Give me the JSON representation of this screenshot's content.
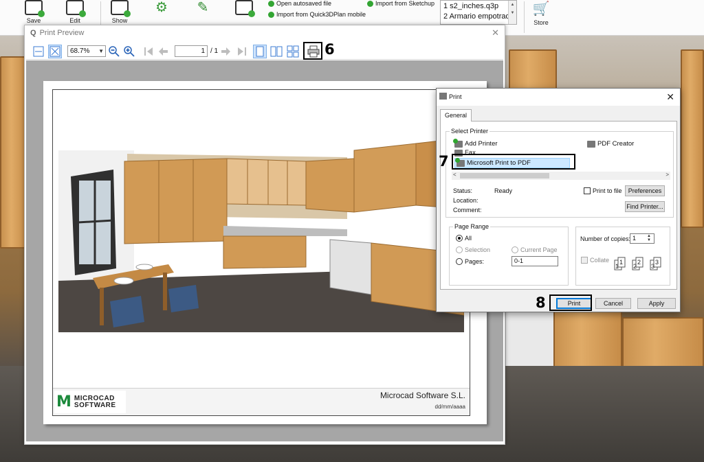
{
  "ribbon": {
    "buttons": [
      {
        "label": "Save",
        "icon": "save-icon"
      },
      {
        "label": "Edit",
        "icon": "edit-icon"
      },
      {
        "label": "Show",
        "icon": "show-icon"
      }
    ],
    "links": {
      "open_autosaved": "Open autosaved file",
      "import_quick3d": "Import from Quick3DPlan mobile",
      "import_sketchup": "Import from Sketchup"
    },
    "recent_files": [
      "1 s2_inches.q3p",
      "2 Armario empotrad"
    ],
    "store_label": "Store"
  },
  "preview": {
    "title": "Print Preview",
    "zoom": "68.7%",
    "page_current": "1",
    "page_total": "/ 1",
    "footer_company": "Microcad Software S.L.",
    "footer_date": "dd/mm/aaaa",
    "logo_line1": "MICROCAD",
    "logo_line2": "SOFTWARE"
  },
  "dialog": {
    "title": "Print",
    "tab_general": "General",
    "select_printer_label": "Select Printer",
    "printers": {
      "add_printer": "Add Printer",
      "fax": "Fax",
      "ms_pdf": "Microsoft Print to PDF",
      "pdf_creator": "PDF Creator"
    },
    "status_label": "Status:",
    "status_value": "Ready",
    "location_label": "Location:",
    "comment_label": "Comment:",
    "print_to_file": "Print to file",
    "preferences": "Preferences",
    "find_printer": "Find Printer...",
    "page_range_label": "Page Range",
    "range_all": "All",
    "range_selection": "Selection",
    "range_current": "Current Page",
    "range_pages": "Pages:",
    "pages_value": "0-1",
    "copies_label": "Number of copies:",
    "copies_value": "1",
    "collate": "Collate",
    "print_btn": "Print",
    "cancel_btn": "Cancel",
    "apply_btn": "Apply"
  },
  "annotations": {
    "step6": "6",
    "step7": "7",
    "step8": "8"
  }
}
